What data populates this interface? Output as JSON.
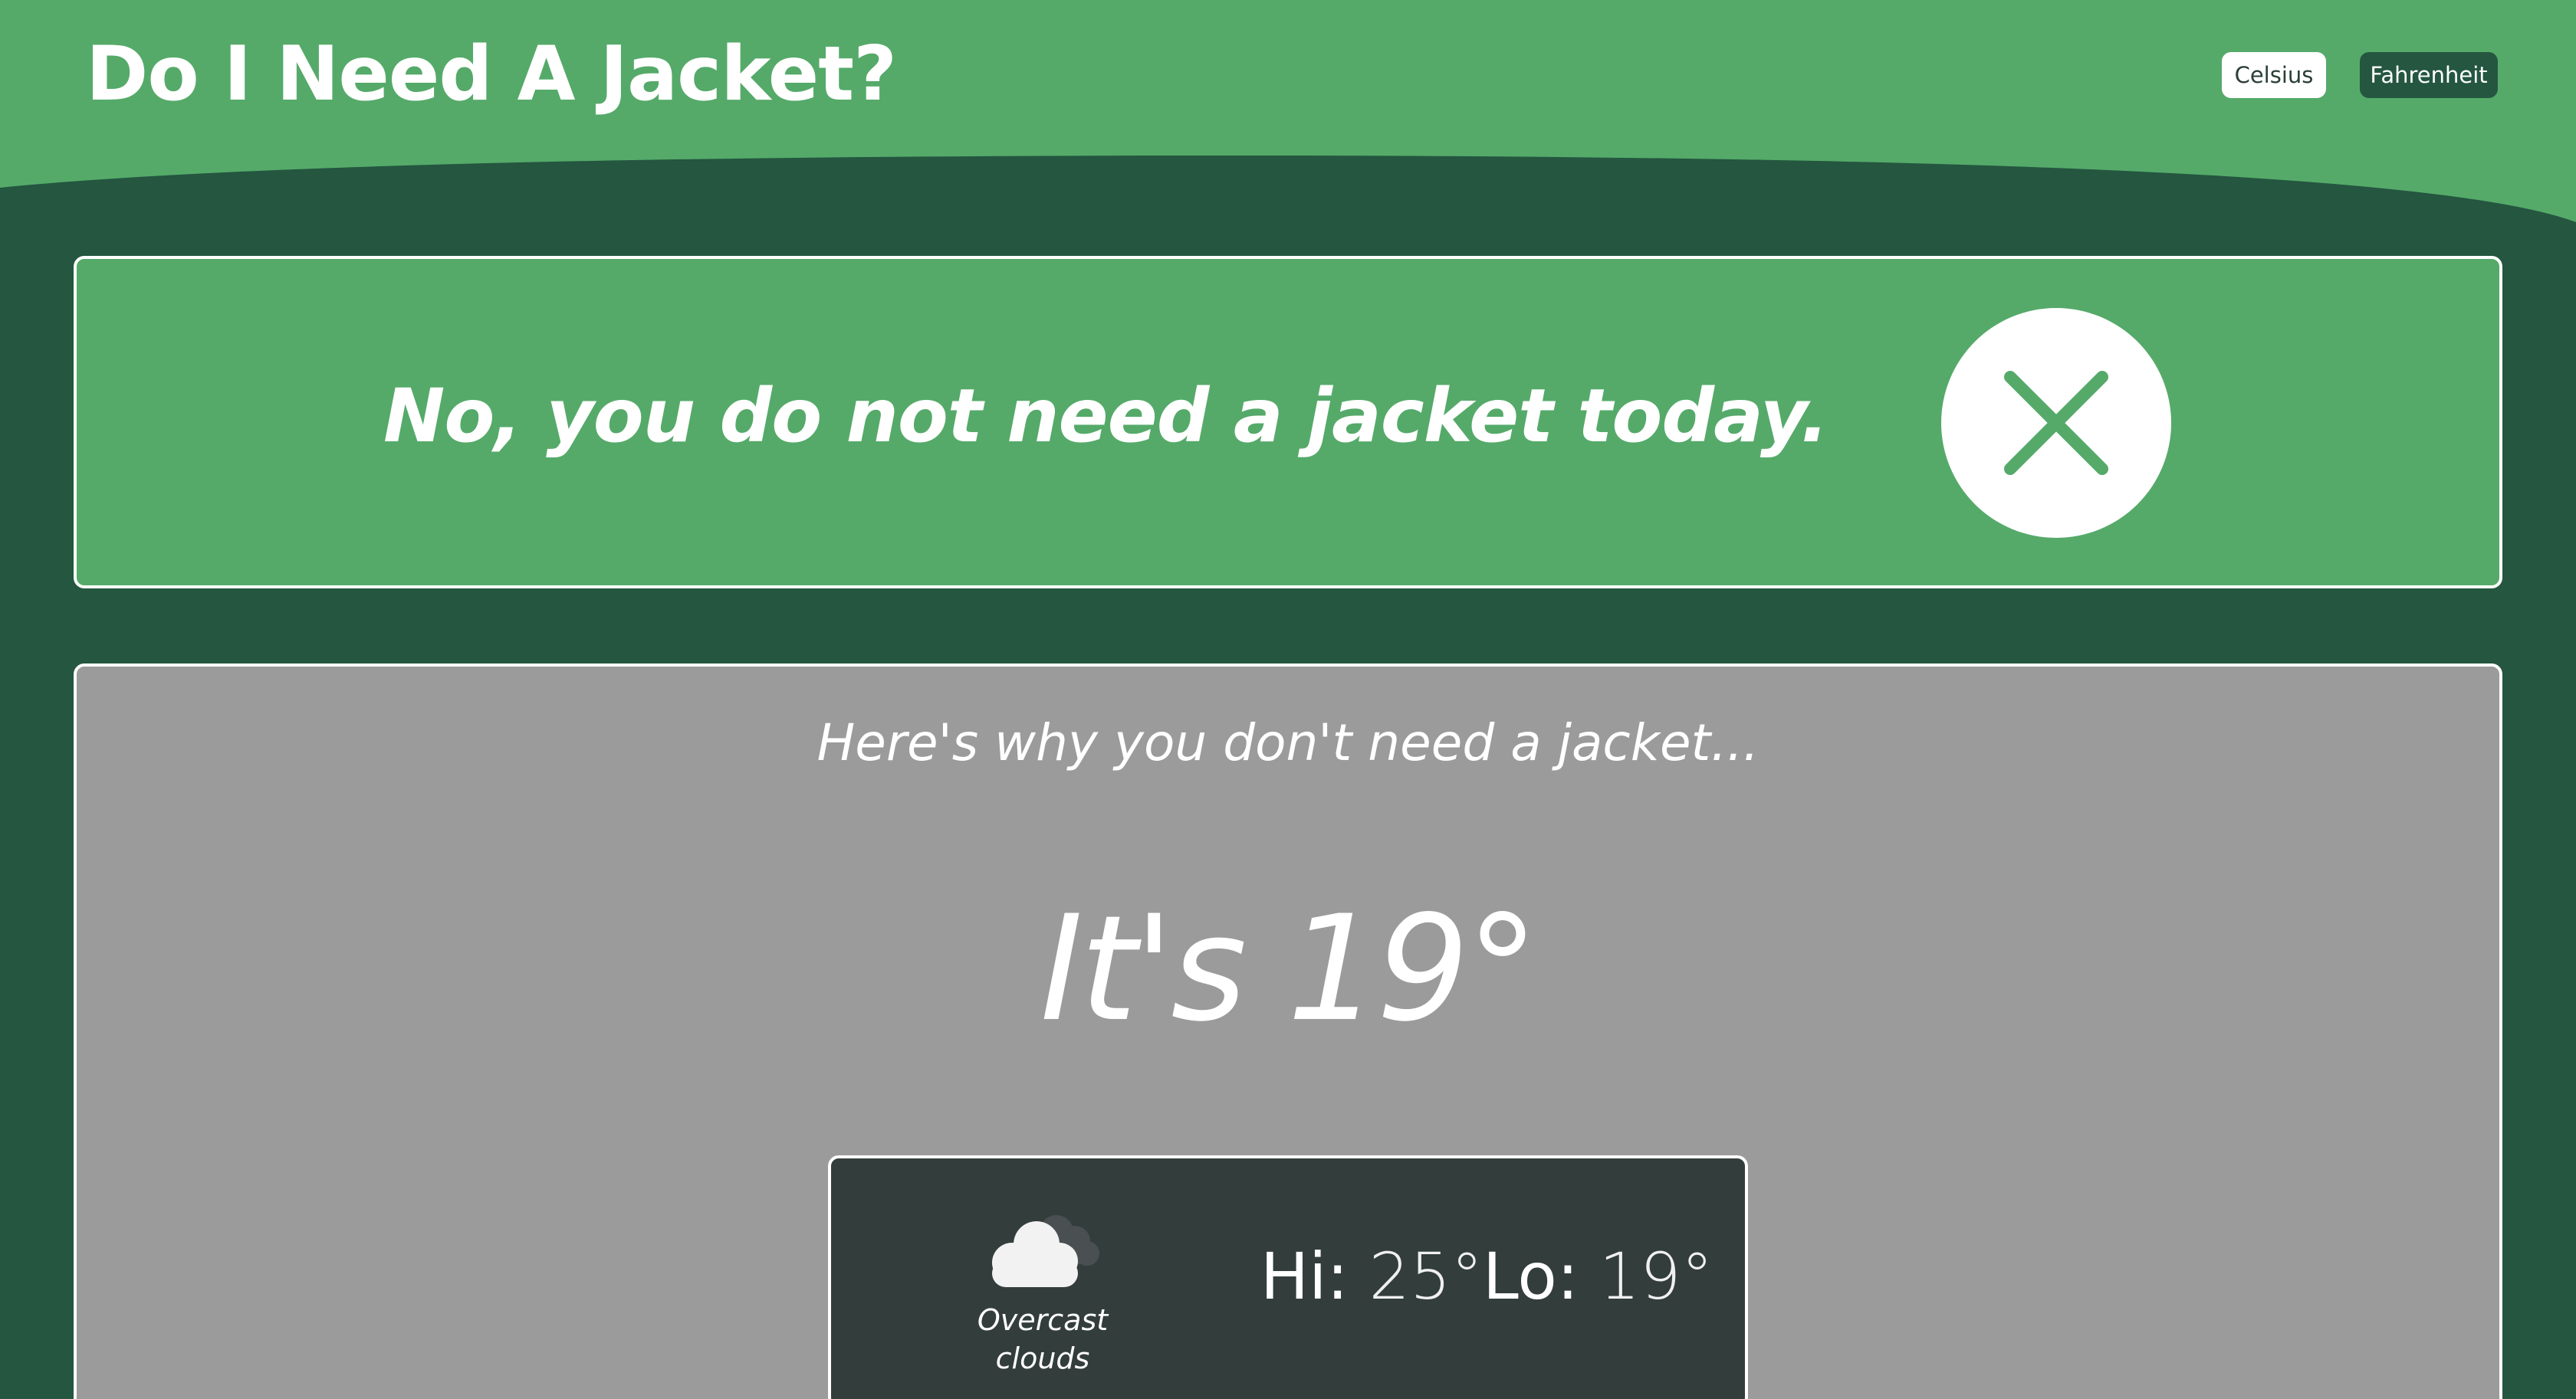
{
  "header": {
    "title": "Do I Need A Jacket?",
    "units": {
      "celsius_label": "Celsius",
      "fahrenheit_label": "Fahrenheit",
      "selected": "Fahrenheit"
    }
  },
  "answer": {
    "text": "No, you do not need a jacket today.",
    "icon": "close-icon"
  },
  "reason": {
    "heading": "Here's why you don't need a jacket...",
    "temperature_text": "It's 19°"
  },
  "weather": {
    "icon": "cloud-icon",
    "condition": "Overcast clouds",
    "hi_label": "Hi:",
    "hi_value": "25°",
    "lo_label": "Lo:",
    "lo_value": "19°"
  },
  "colors": {
    "header_green": "#55aa69",
    "dark_green": "#245640",
    "card_gray": "#9b9b9b",
    "panel_dark": "#333d3c",
    "white": "#ffffff"
  }
}
